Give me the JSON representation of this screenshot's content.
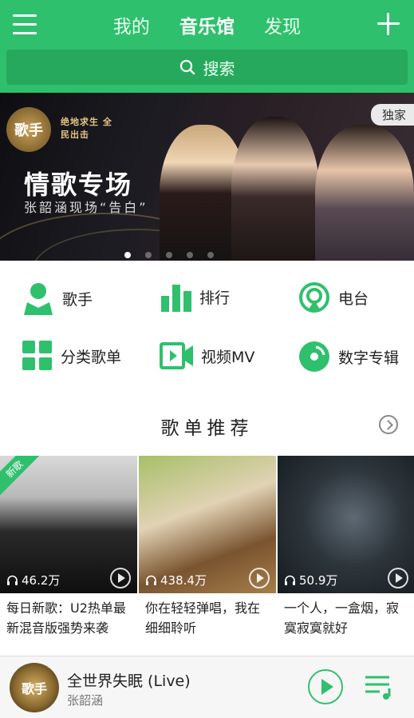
{
  "header": {
    "tabs": [
      {
        "label": "我的"
      },
      {
        "label": "音乐馆"
      },
      {
        "label": "发现"
      }
    ],
    "search": {
      "label": "搜索"
    }
  },
  "banner": {
    "title": "情歌专场",
    "subtitle": "张韶涵现场“告白”",
    "badge": "独家",
    "logo_text": "歌手",
    "logo2_text": "绝地求生 全民出击",
    "dots": 5,
    "active_dot": 0
  },
  "categories": [
    {
      "label": "歌手",
      "icon": "singer-icon"
    },
    {
      "label": "排行",
      "icon": "chart-icon"
    },
    {
      "label": "电台",
      "icon": "radio-icon"
    },
    {
      "label": "分类歌单",
      "icon": "grid-icon"
    },
    {
      "label": "视频MV",
      "icon": "video-icon"
    },
    {
      "label": "数字专辑",
      "icon": "disc-icon"
    }
  ],
  "section": {
    "title": "歌单推荐"
  },
  "playlists": [
    {
      "count": "46.2万",
      "desc": "每日新歌：U2热单最新混音版强势来袭",
      "badge": "新歌"
    },
    {
      "count": "438.4万",
      "desc": "你在轻轻弹唱，我在细细聆听"
    },
    {
      "count": "50.9万",
      "desc": "一个人，一盒烟，寂寞寂寞就好"
    }
  ],
  "player": {
    "song": "全世界失眠 (Live)",
    "artist": "张韶涵",
    "cover_text": "歌手"
  },
  "colors": {
    "accent": "#2fc06d"
  }
}
